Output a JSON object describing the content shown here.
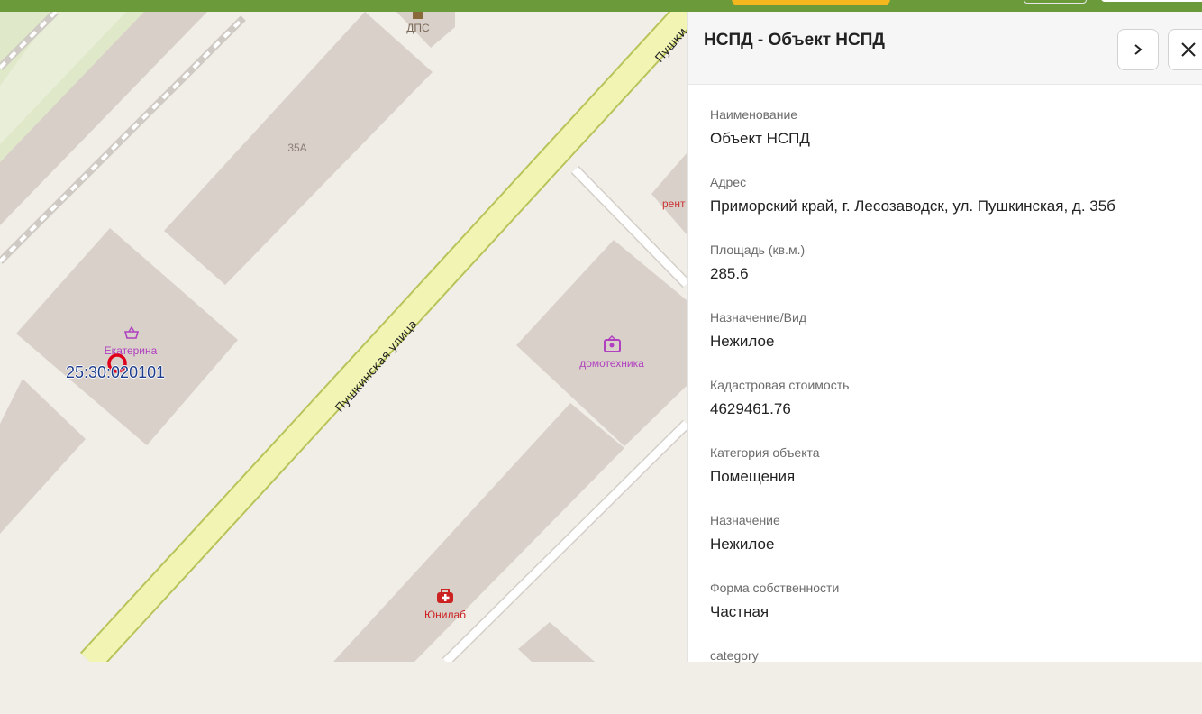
{
  "topbar": {},
  "map": {
    "labels": {
      "dps": "ДПС",
      "bldg_35a": "35А",
      "street_top": "Пушки",
      "rent": "рент",
      "street_main": "Пушкинская улица",
      "shop_ekaterina": "Екатерина",
      "cadastral": "25:30:020101",
      "domotekhnika": "домотехника",
      "yunilab": "Юнилаб"
    },
    "colors": {
      "background": "#f1eee8",
      "building": "#d9d0c9",
      "road": "#f2f4b4",
      "road_edge": "#b8c45a",
      "park": "#dfe8c9",
      "marker": "#e0001b",
      "cadastral_text": "#1d3d8c"
    }
  },
  "panel": {
    "title": "НСПД - Объект НСПД",
    "next_icon": "chevron-right-icon",
    "close_icon": "close-icon",
    "fields": [
      {
        "label": "Наименование",
        "value": "Объект НСПД"
      },
      {
        "label": "Адрес",
        "value": "Приморский край, г. Лесозаводск, ул. Пушкинская, д. 35б"
      },
      {
        "label": "Площадь (кв.м.)",
        "value": "285.6"
      },
      {
        "label": "Назначение/Вид",
        "value": "Нежилое"
      },
      {
        "label": "Кадастровая стоимость",
        "value": "4629461.76"
      },
      {
        "label": "Категория объекта",
        "value": "Помещения"
      },
      {
        "label": "Назначение",
        "value": "Нежилое"
      },
      {
        "label": "Форма собственности",
        "value": "Частная"
      },
      {
        "label": "category",
        "value": ""
      }
    ]
  }
}
